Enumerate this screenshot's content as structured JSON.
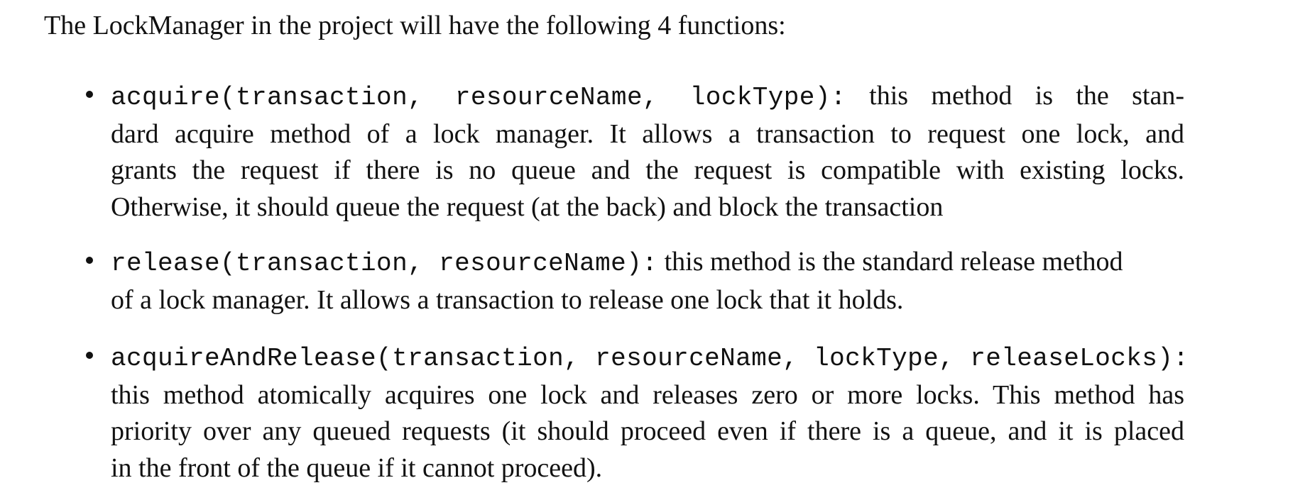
{
  "intro": "The LockManager in the project will have the following 4 functions:",
  "items": [
    {
      "signature": "acquire(transaction, resourceName, lockType):",
      "lines": [
        "this method is the stan-",
        "dard acquire method of a lock manager.  It allows a transaction to request one lock, and",
        "grants the request if there is no queue and the request is compatible with existing locks.",
        "Otherwise, it should queue the request (at the back) and block the transaction"
      ]
    },
    {
      "signature": "release(transaction, resourceName):",
      "lines": [
        "this method is the standard release method",
        "of a lock manager. It allows a transaction to release one lock that it holds."
      ]
    },
    {
      "signature": "acquireAndRelease(transaction, resourceName, lockType, releaseLocks):",
      "lines": [
        "this method atomically acquires one lock and releases zero or more locks.  This method has",
        "priority over any queued requests (it should proceed even if there is a queue, and it is placed",
        "in the front of the queue if it cannot proceed)."
      ]
    }
  ]
}
